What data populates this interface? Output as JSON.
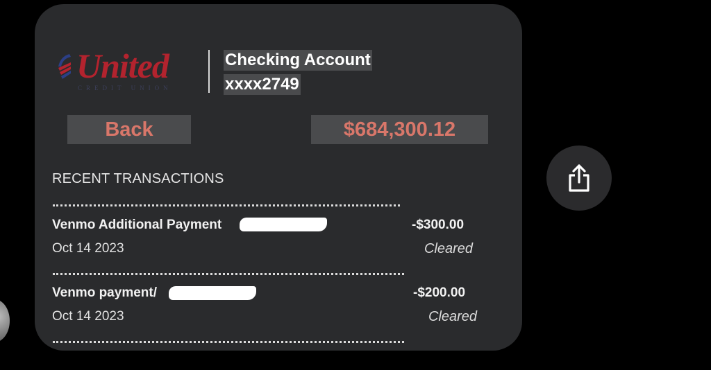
{
  "logo": {
    "name": "United",
    "subtitle": "CREDIT UNION"
  },
  "account": {
    "title": "Checking Account",
    "number": "xxxx2749"
  },
  "actions": {
    "back_label": "Back"
  },
  "balance": "$684,300.12",
  "transactions": {
    "header": "RECENT TRANSACTIONS",
    "items": [
      {
        "description": "Venmo Additional Payment",
        "date": "Oct 14 2023",
        "amount": "-$300.00",
        "status": "Cleared"
      },
      {
        "description": "Venmo payment/",
        "date": "Oct 14 2023",
        "amount": "-$200.00",
        "status": "Cleared"
      }
    ]
  },
  "share": {
    "icon": "share-icon"
  },
  "colors": {
    "card_bg": "#2a2b2d",
    "accent_red": "#b3232e",
    "balance_text": "#d9776a",
    "highlight_bg": "#4a4b4d"
  }
}
